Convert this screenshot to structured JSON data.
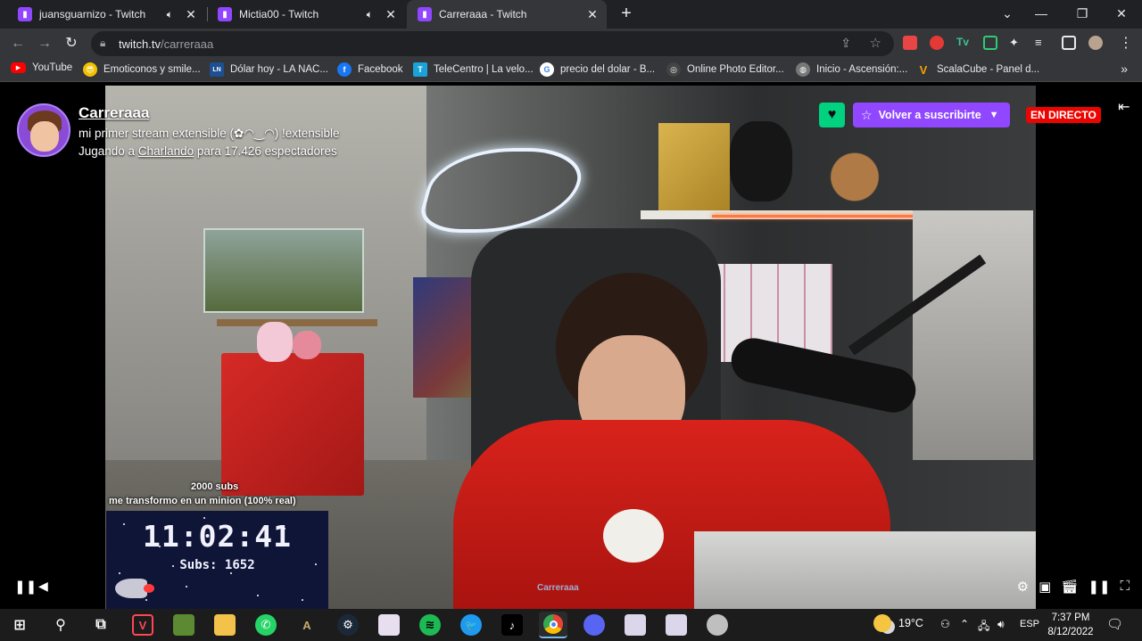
{
  "browser": {
    "tabs": [
      {
        "title": "juansguarnizo - Twitch",
        "audio": true,
        "active": false
      },
      {
        "title": "Mictia00 - Twitch",
        "audio": true,
        "active": false
      },
      {
        "title": "Carreraaa - Twitch",
        "audio": false,
        "active": true
      }
    ],
    "new_tab_glyph": "+",
    "url_host": "twitch.tv",
    "url_path": "/carreraaa",
    "window_controls": [
      "⌄",
      "—",
      "❐",
      "✕"
    ]
  },
  "bookmarks": [
    {
      "label": "YouTube",
      "color": "#ff0000",
      "glyph": "▶"
    },
    {
      "label": "Emoticonos y smile...",
      "color": "#f2c200",
      "glyph": "😎"
    },
    {
      "label": "Dólar hoy - LA NAC...",
      "color": "#1d4f91",
      "glyph": "LN"
    },
    {
      "label": "Facebook",
      "color": "#1877f2",
      "glyph": "f"
    },
    {
      "label": "TeleCentro | La velo...",
      "color": "#1aa3d9",
      "glyph": "T"
    },
    {
      "label": "precio del dolar - B...",
      "color": "#ffffff",
      "glyph": "G"
    },
    {
      "label": "Online Photo Editor...",
      "color": "#444444",
      "glyph": "◎"
    },
    {
      "label": "Inicio - Ascensión:...",
      "color": "#777777",
      "glyph": "◍"
    },
    {
      "label": "ScalaCube - Panel d...",
      "color": "#f5a300",
      "glyph": "V"
    }
  ],
  "stream": {
    "channel": "Carreraaa",
    "title": "mi primer stream extensible (✿◠‿◠) !extensible",
    "playing_prefix": "Jugando a ",
    "game": "Charlando",
    "viewers_suffix": " para 17.426 espectadores",
    "follow_icon": "heart-icon",
    "subscribe_label": "Volver a suscribirte",
    "live_label": "EN DIRECTO",
    "goal_line1": "2000 subs",
    "goal_line2": "me transformo en un minion (100% real)",
    "timer": "11:02:41",
    "subs_label": "Subs: 1652",
    "watermark": "Carreraaa"
  },
  "taskbar": {
    "apps": [
      {
        "name": "windows-start",
        "color": "#1c1c1c",
        "glyph": "⊞"
      },
      {
        "name": "search",
        "color": "#1c1c1c",
        "glyph": "⚲"
      },
      {
        "name": "task-view",
        "color": "#1c1c1c",
        "glyph": "⧉"
      },
      {
        "name": "valorant",
        "color": "#1c1c1c",
        "glyph": "V"
      },
      {
        "name": "minecraft",
        "color": "#5b8a32",
        "glyph": ""
      },
      {
        "name": "file-explorer",
        "color": "#f2c24b",
        "glyph": ""
      },
      {
        "name": "whatsapp",
        "color": "#25d366",
        "glyph": "✆"
      },
      {
        "name": "league",
        "color": "#c8aa6e",
        "glyph": "A"
      },
      {
        "name": "steam",
        "color": "#1b2838",
        "glyph": "⚙"
      },
      {
        "name": "anime-app",
        "color": "#e7dff0",
        "glyph": ""
      },
      {
        "name": "spotify",
        "color": "#1db954",
        "glyph": "≋"
      },
      {
        "name": "twitter",
        "color": "#1d9bf0",
        "glyph": "🐦"
      },
      {
        "name": "tiktok",
        "color": "#000000",
        "glyph": "♪"
      },
      {
        "name": "chrome",
        "color": "#4285f4",
        "glyph": ""
      },
      {
        "name": "discord",
        "color": "#5865f2",
        "glyph": ""
      },
      {
        "name": "anime-app-2",
        "color": "#dcd6ea",
        "glyph": ""
      },
      {
        "name": "anime-app-3",
        "color": "#dcd6ea",
        "glyph": ""
      },
      {
        "name": "generic-app",
        "color": "#bfbfbf",
        "glyph": ""
      }
    ],
    "temperature": "19°C",
    "language": "ESP",
    "time": "7:37 PM",
    "date": "8/12/2022"
  }
}
